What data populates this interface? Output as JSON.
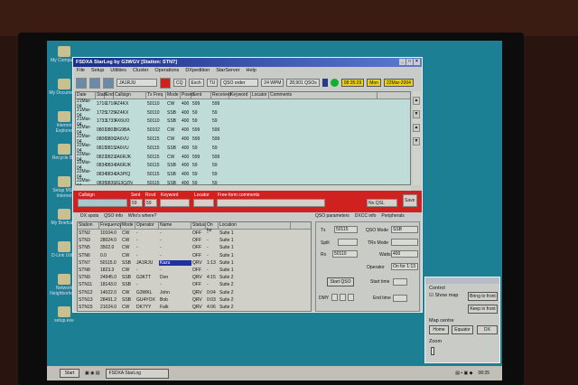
{
  "desktop": {
    "icons": [
      "My Computer",
      "My Documents",
      "Internet Explorer",
      "Recycle Bin",
      "Setup MSN Internet",
      "My Briefcase",
      "D-Link Utility",
      "Network Neighborhood",
      "setup.exe"
    ]
  },
  "app": {
    "title": "FSDXA StarLog by G3WGV [Station: STN7]",
    "menu": [
      "File",
      "Setup",
      "Utilities",
      "Cluster",
      "Operations",
      "DXpedition",
      "StarServer",
      "Help"
    ],
    "toolbar": {
      "operator": "JA1RJU",
      "cq": "CQ",
      "exch": "Exch",
      "tu": "TU",
      "order": "QSO order",
      "wpm": "24 WPM",
      "qsos": "28,901 QSOs",
      "time": "08:35:29",
      "day": "Mon",
      "date": "22Mar-2004"
    },
    "log": {
      "columns": [
        "Date",
        "Start",
        "End",
        "Callsign",
        "Tx Freq",
        "Mode",
        "Power",
        "Sent",
        "Received",
        "Keyword",
        "Locator",
        "Comments"
      ],
      "rows": [
        [
          "21Mar-04",
          "1716",
          "1716",
          "4Z4KX",
          "50110",
          "CW",
          "400",
          "599",
          "599"
        ],
        [
          "21Mar-04",
          "1725",
          "1725",
          "4Z4KX",
          "50110",
          "SSB",
          "400",
          "59",
          "59"
        ],
        [
          "21Mar-04",
          "1733",
          "1733",
          "4X6UO",
          "50110",
          "SSB",
          "400",
          "59",
          "59"
        ],
        [
          "22Mar-04",
          "0801",
          "0801",
          "BG9BA",
          "50102",
          "CW",
          "400",
          "599",
          "599"
        ],
        [
          "22Mar-04",
          "0806",
          "0806",
          "JA6VU",
          "50115",
          "CW",
          "400",
          "599",
          "599"
        ],
        [
          "22Mar-04",
          "0815",
          "0815",
          "JA6VU",
          "50115",
          "SSB",
          "400",
          "59",
          "59"
        ],
        [
          "22Mar-04",
          "0823",
          "0823",
          "JA6RJK",
          "50115",
          "CW",
          "400",
          "599",
          "599"
        ],
        [
          "22Mar-04",
          "0834",
          "0834",
          "JA6RJK",
          "50115",
          "SSB",
          "400",
          "59",
          "59"
        ],
        [
          "22Mar-04",
          "0834",
          "0834",
          "JA3PIQ",
          "50115",
          "SSB",
          "400",
          "59",
          "59"
        ],
        [
          "22Mar-04",
          "0835",
          "0835",
          "JG3QZN",
          "50115",
          "SSB",
          "400",
          "59",
          "59"
        ]
      ]
    },
    "entry": {
      "callsign_label": "Callsign",
      "sent_label": "Sent",
      "rcvd_label": "Rcvd",
      "keyword_label": "Keyword",
      "locator_label": "Locator",
      "comments_label": "Free-form comments",
      "sent": "59",
      "rcvd": "59",
      "qsl": "No QSL",
      "save": "Save"
    },
    "left_tabs": [
      "DX spots",
      "QSO info",
      "Who's where?"
    ],
    "right_tabs": [
      "QSO parameters",
      "DXCC info",
      "Peripherals"
    ],
    "stations": {
      "columns": [
        "Station",
        "Frequency",
        "Mode",
        "Operator",
        "Name",
        "Status",
        "On for",
        "Location"
      ],
      "rows": [
        [
          "STN2",
          "10104.0",
          "CW",
          "-",
          "-",
          "OFF",
          "-",
          "Suite 1"
        ],
        [
          "STN3",
          "28024.0",
          "CW",
          "-",
          "-",
          "OFF",
          "-",
          "Suite 1"
        ],
        [
          "STN5",
          "3502.0",
          "CW",
          "-",
          "-",
          "OFF",
          "-",
          "Suite 1"
        ],
        [
          "STN6",
          "0.0",
          "CW",
          "-",
          "-",
          "OFF",
          "-",
          "Suite 1"
        ],
        [
          "STN7",
          "50115.0",
          "SSB",
          "JA1RJU",
          "Kazu",
          "QRV",
          "1:13",
          "Suite 1"
        ],
        [
          "STN8",
          "1823.3",
          "CW",
          "-",
          "-",
          "OFF",
          "-",
          "Suite 1"
        ],
        [
          "STN9",
          "24945.0",
          "SSB",
          "G3KTT",
          "Don",
          "QRV",
          "4:15",
          "Suite 2"
        ],
        [
          "STN11",
          "18143.0",
          "SSB",
          "-",
          "-",
          "OFF",
          "-",
          "Suite 2"
        ],
        [
          "STN12",
          "14022.0",
          "CW",
          "G3WKL",
          "John",
          "QRV",
          "0:04",
          "Suite 2"
        ],
        [
          "STN13",
          "28491.2",
          "SSB",
          "GU4YOX",
          "Bob",
          "QRV",
          "0:03",
          "Suite 2"
        ],
        [
          "STN15",
          "21024.0",
          "CW",
          "DK7YY",
          "Falk",
          "QRV",
          "4:06",
          "Suite 2"
        ]
      ]
    },
    "qso": {
      "tx_label": "Tx",
      "tx": "50115",
      "split_label": "Split",
      "rx_label": "Rx",
      "rx": "50110",
      "mode_label": "QSO Mode",
      "mode": "SSB",
      "trx_label": "TRx Mode",
      "watts_label": "Watts",
      "watts": "400",
      "operator_label": "Operator",
      "operator": "On for 1:13",
      "start_qso": "Start QSO",
      "start_time": "Start time",
      "end_time": "End time",
      "dmy": "DMY"
    }
  },
  "map": {
    "control": "Control",
    "show_map": "Show map",
    "bring": "Bring to front",
    "keep": "Keep in front",
    "centre": "Map centre",
    "home": "Home",
    "equator": "Equator",
    "dx": "DX",
    "zoom": "Zoom"
  },
  "taskbar": {
    "start": "Start",
    "task": "FSDXA StarLog",
    "clock": "08:35"
  }
}
